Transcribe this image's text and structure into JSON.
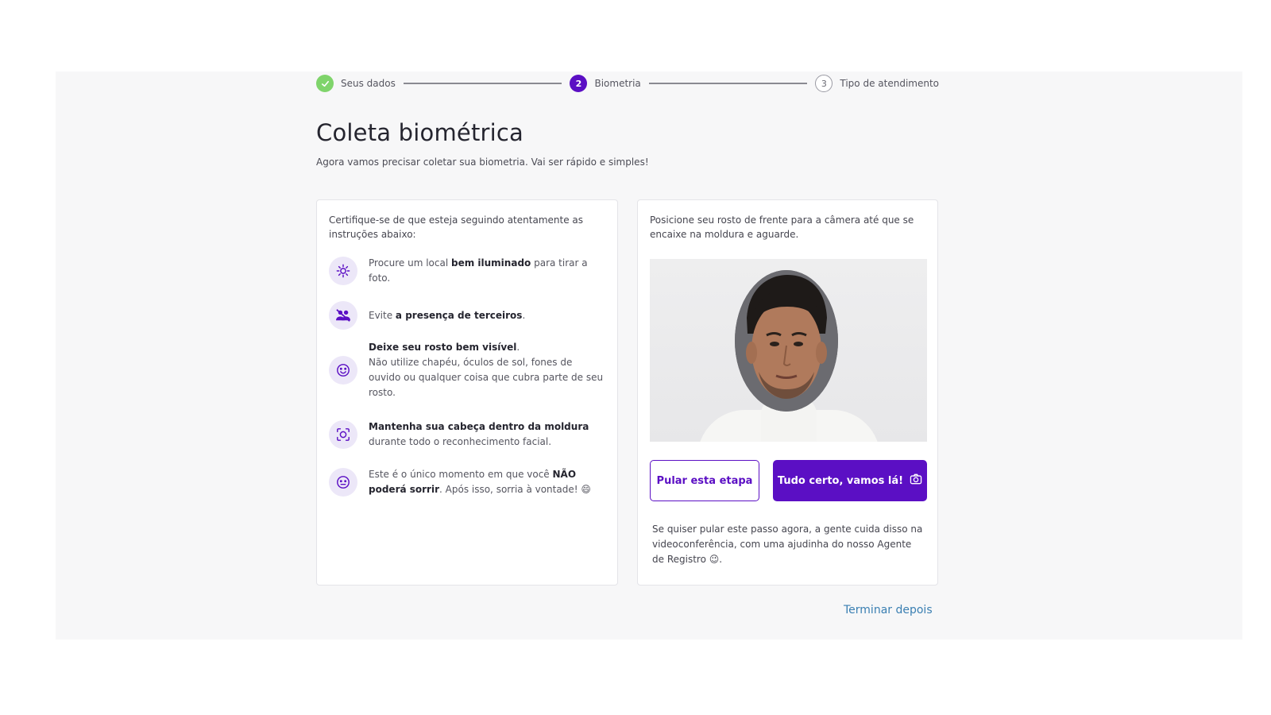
{
  "stepper": {
    "steps": [
      {
        "label": "Seus dados",
        "marker": "",
        "state": "done"
      },
      {
        "label": "Biometria",
        "marker": "2",
        "state": "current"
      },
      {
        "label": "Tipo de atendimento",
        "marker": "3",
        "state": "next"
      }
    ]
  },
  "header": {
    "title": "Coleta biométrica",
    "subtitle": "Agora vamos precisar coletar sua biometria. Vai ser rápido e simples!"
  },
  "instructions_card": {
    "intro": "Certifique-se de que esteja seguindo atentamente as instruções abaixo:",
    "items": [
      {
        "icon": "sun-icon",
        "pre": "Procure um local ",
        "bold": "bem iluminado",
        "post": " para tirar a foto."
      },
      {
        "icon": "people-crossed-icon",
        "pre": "Evite ",
        "bold": "a presença de terceiros",
        "post": "."
      },
      {
        "icon": "smiley-icon",
        "bold": "Deixe seu rosto bem visível",
        "post": ".",
        "extra": "Não utilize chapéu, óculos de sol, fones de ouvido ou qualquer coisa que cubra parte de seu rosto."
      },
      {
        "icon": "face-scan-icon",
        "bold": "Mantenha sua cabeça dentro da moldura",
        "post": " durante todo o reconhecimento facial."
      },
      {
        "icon": "neutral-face-icon",
        "pre": "Este é o único momento em que você ",
        "bold": "NÃO poderá sorrir",
        "post": ". Após isso, sorria à vontade! 😄"
      }
    ]
  },
  "camera_card": {
    "intro": "Posicione seu rosto de frente para a câmera até que se encaixe na moldura e aguarde.",
    "skip_button": "Pular esta etapa",
    "confirm_button": "Tudo certo, vamos lá!",
    "confirm_icon": "camera-icon",
    "skip_note": "Se quiser pular este passo agora, a gente cuida disso na videoconferência, com uma ajudinha do nosso Agente de Registro 😉."
  },
  "footer": {
    "finish_later": "Terminar depois"
  },
  "colors": {
    "primary": "#5b0fc4",
    "done": "#7fd46b",
    "link": "#3a7fb2",
    "icon_bg": "#ece7f8"
  }
}
